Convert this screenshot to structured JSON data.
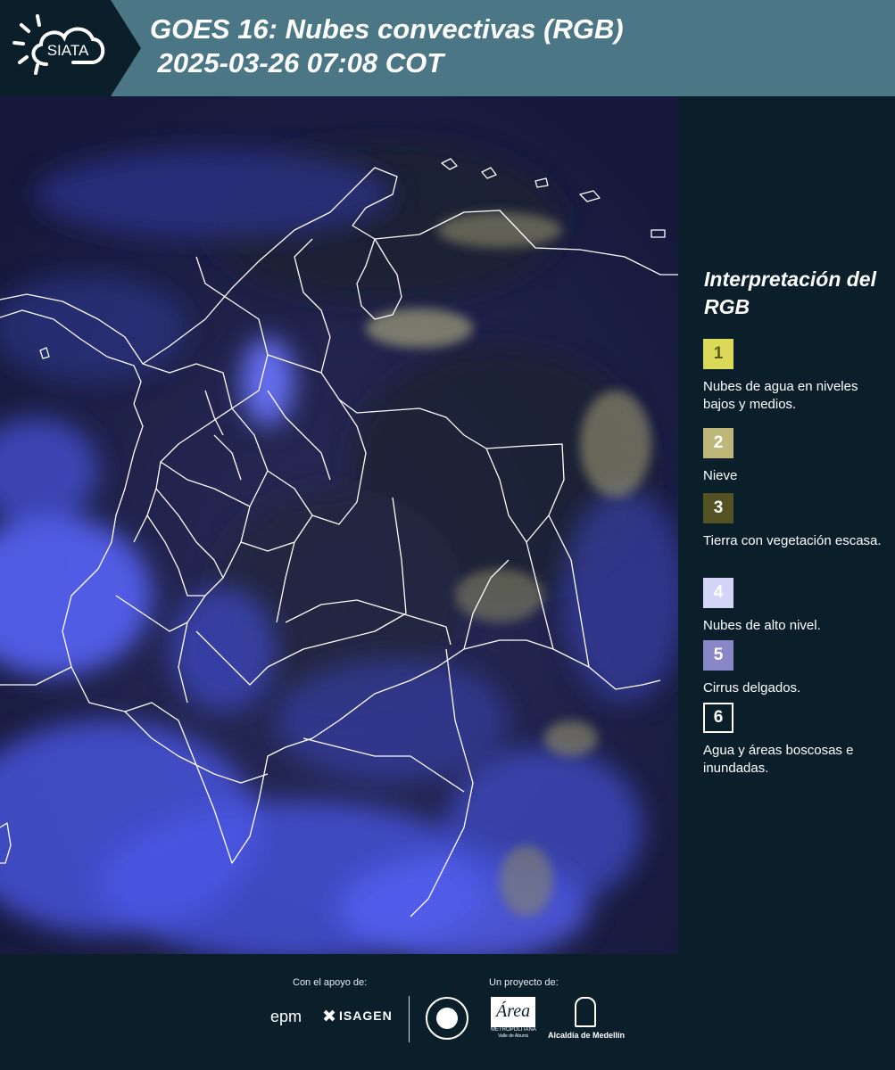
{
  "header": {
    "logo_text": "SIATA",
    "title": "GOES 16: Nubes convectivas (RGB)\n 2025-03-26 07:08 COT"
  },
  "legend": {
    "title": "Interpretación del RGB",
    "items": [
      {
        "number": "1",
        "label": "Nubes de agua en niveles bajos y medios.",
        "color": "#dada58",
        "text_color": "#5a5a1a"
      },
      {
        "number": "2",
        "label": "Nieve",
        "color": "#bdb87a",
        "text_color": "#ffffff"
      },
      {
        "number": "3",
        "label": "Tierra con vegetación escasa.",
        "color": "#545222",
        "text_color": "#ffffff"
      },
      {
        "number": "4",
        "label": "Nubes de alto nivel.",
        "color": "#d4d4f6",
        "text_color": "#ffffff"
      },
      {
        "number": "5",
        "label": "Cirrus delgados.",
        "color": "#8a87c8",
        "text_color": "#ffffff"
      },
      {
        "number": "6",
        "label": "Agua y áreas boscosas e inundadas.",
        "color": "#0b1f2b",
        "text_color": "#ffffff"
      }
    ]
  },
  "footer": {
    "support_label": "Con el apoyo de:",
    "project_label": "Un proyecto de:",
    "sponsors": [
      "epm",
      "ISAGEN"
    ],
    "partners": [
      "Área Metropolitana Valle de Aburrá",
      "Alcaldía de Medellín"
    ],
    "area_text": "Área",
    "area_sub": "METROPOLITANA",
    "area_sub2": "Valle de Aburrá",
    "alcaldia_text": "Alcaldía de Medellín"
  },
  "colors": {
    "header_bg": "#4a7686",
    "panel_bg": "#0b1f2b",
    "map_base": "#1b1e3e",
    "high_cloud": "#5a66ff",
    "low_cloud": "#c8c48a",
    "border": "#ffffff"
  },
  "icons": [
    "siata-logo-icon",
    "epm-logo-icon",
    "isagen-logo-icon",
    "medellin-seal-icon",
    "area-metropolitana-logo-icon",
    "alcaldia-medellin-logo-icon"
  ]
}
